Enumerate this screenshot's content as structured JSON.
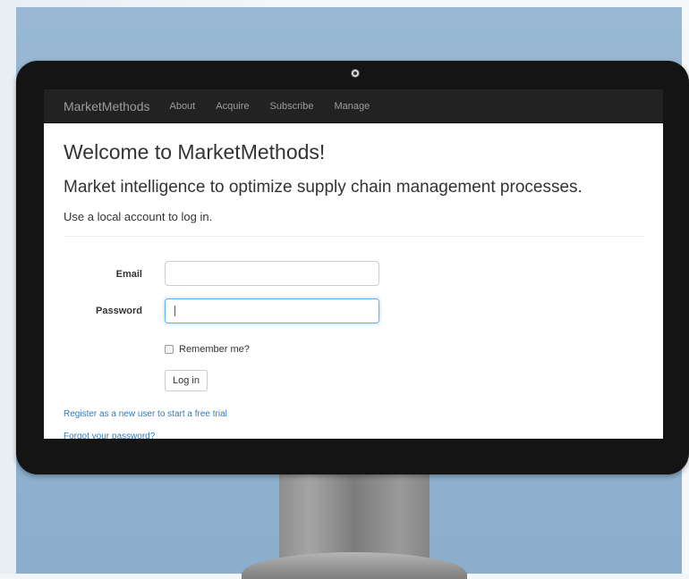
{
  "navbar": {
    "brand": "MarketMethods",
    "links": [
      "About",
      "Acquire",
      "Subscribe",
      "Manage"
    ]
  },
  "page": {
    "heading": "Welcome to MarketMethods!",
    "tagline": "Market intelligence to optimize supply chain management processes.",
    "subheading": "Use a local account to log in."
  },
  "form": {
    "email_label": "Email",
    "email_value": "",
    "password_label": "Password",
    "password_value": "",
    "remember_label": "Remember me?",
    "login_button": "Log in"
  },
  "links": {
    "register": "Register as a new user to start a free trial",
    "forgot": "Forgot your password?"
  },
  "colors": {
    "navbar_bg": "#222222",
    "link": "#337ab7",
    "focus_border": "#66afe9"
  }
}
